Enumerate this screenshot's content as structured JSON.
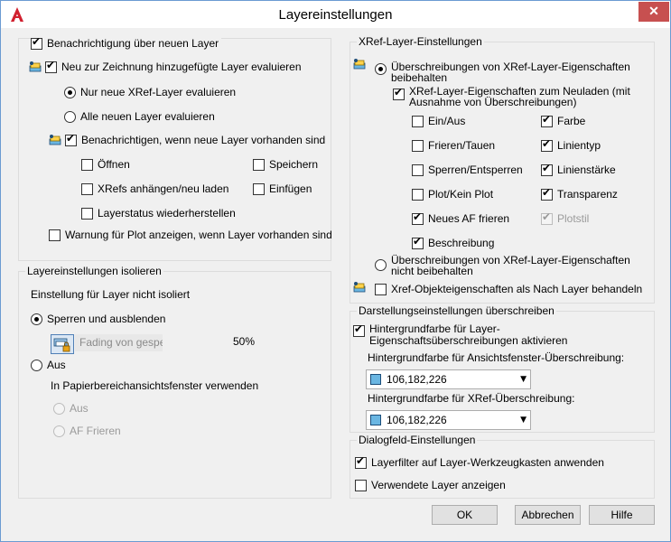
{
  "window": {
    "title": "Layereinstellungen",
    "close_glyph": "✕"
  },
  "notify_new_layers": {
    "label": "Benachrichtigung über neuen Layer",
    "checked": true
  },
  "evaluate_new_layers": {
    "label": "Neu zur Zeichnung hinzugefügte Layer evaluieren",
    "checked": true
  },
  "only_xref": {
    "label": "Nur neue XRef-Layer evaluieren",
    "checked": true
  },
  "all_new": {
    "label": "Alle neuen Layer evaluieren",
    "checked": false
  },
  "notify_when": {
    "label": "Benachrichtigen, wenn neue Layer vorhanden sind",
    "checked": true
  },
  "notify_options": {
    "open": "Öffnen",
    "save": "Speichern",
    "xrefs": "XRefs anhängen/neu laden",
    "insert": "Einfügen",
    "restore": "Layerstatus wiederherstellen"
  },
  "plot_warning": "Warnung für Plot anzeigen, wenn Layer vorhanden sind",
  "isolate": {
    "legend": "Layereinstellungen isolieren",
    "setting_label": "Einstellung für Layer nicht isoliert",
    "lock_fade": "Sperren und ausblenden",
    "fading_label": "Fading von gesperrtem Layer",
    "fading_value": "50%",
    "off": "Aus",
    "paper_label": "In Papierbereichansichtsfenster verwenden",
    "paper_off": "Aus",
    "paper_freeze": "AF Frieren"
  },
  "xref": {
    "legend": "XRef-Layer-Einstellungen",
    "keep_overrides": "Überschreibungen von XRef-Layer-Eigenschaften beibehalten",
    "reload_props": "XRef-Layer-Eigenschaften zum Neuladen (mit Ausnahme von Überschreibungen)",
    "props": {
      "onoff": "Ein/Aus",
      "color": "Farbe",
      "freeze": "Frieren/Tauen",
      "linetype": "Linientyp",
      "lock": "Sperren/Entsperren",
      "lineweight": "Linienstärke",
      "plot": "Plot/Kein Plot",
      "transparency": "Transparenz",
      "vp_freeze": "Neues AF frieren",
      "plotstyle": "Plotstil",
      "description": "Beschreibung"
    },
    "no_keep": "Überschreibungen von XRef-Layer-Eigenschaften nicht beibehalten",
    "bylayer": "Xref-Objekteigenschaften als Nach Layer behandeln"
  },
  "display": {
    "legend": "Darstellungseinstellungen überschreiben",
    "bg_enable": "Hintergrundfarbe für Layer-Eigenschaftsüberschreibungen aktivieren",
    "vp_color_label": "Hintergrundfarbe für Ansichtsfenster-Überschreibung:",
    "vp_color_value": "106,182,226",
    "xref_color_label": "Hintergrundfarbe für XRef-Überschreibung:",
    "xref_color_value": "106,182,226",
    "swatch_color": "#6ab6e2"
  },
  "dialog": {
    "legend": "Dialogfeld-Einstellungen",
    "apply_filter": "Layerfilter auf Layer-Werkzeugkasten anwenden",
    "show_used": "Verwendete Layer anzeigen"
  },
  "buttons": {
    "ok": "OK",
    "cancel": "Abbrechen",
    "help": "Hilfe"
  }
}
